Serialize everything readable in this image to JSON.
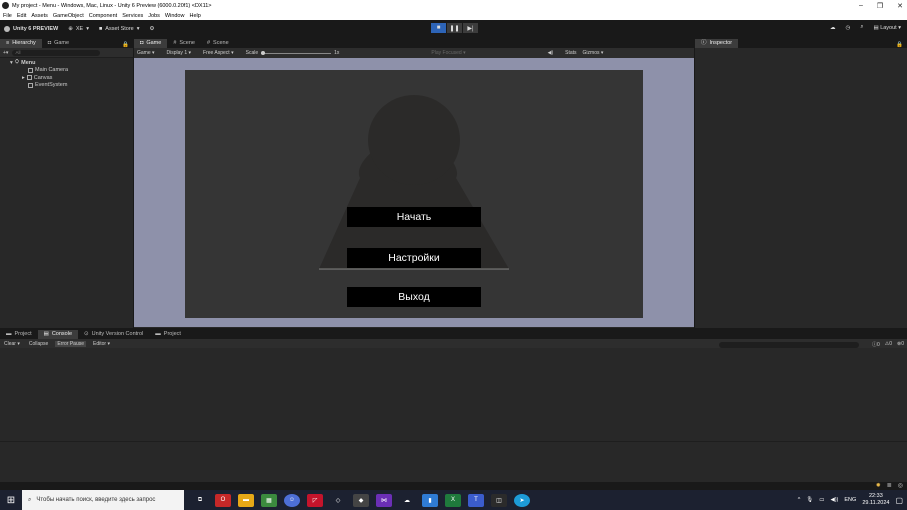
{
  "window": {
    "title": "My project - Menu - Windows, Mac, Linux - Unity 6 Preview (6000.0.20f1) <DX11>",
    "controls": [
      "–",
      "❐",
      "✕"
    ]
  },
  "menubar": [
    "File",
    "Edit",
    "Assets",
    "GameObject",
    "Component",
    "Services",
    "Jobs",
    "Window",
    "Help"
  ],
  "toolbar": {
    "brand": "Unity 6 PREVIEW",
    "account": "XE",
    "asset_store": "Asset Store",
    "layout": "Layout"
  },
  "hierarchy": {
    "tabs": [
      "Hierarchy",
      "Game"
    ],
    "search_placeholder": "All",
    "scene": "Menu",
    "items": [
      "Main Camera",
      "Canvas",
      "EventSystem"
    ]
  },
  "center": {
    "tabs": [
      "Game",
      "Scene",
      "Scene"
    ],
    "game_toolbar": {
      "mode": "Game",
      "display": "Display 1",
      "aspect": "Free Aspect",
      "scale_label": "Scale",
      "scale_value": "1x",
      "play_focused": "Play Focused",
      "stats": "Stats",
      "gizmos": "Gizmos"
    },
    "game_menu": {
      "buttons": [
        "Начать",
        "Настройки",
        "Выход"
      ],
      "colors": {
        "screen_bg": "#353535",
        "button_bg": "#000000",
        "button_text": "#ffffff",
        "silhouette": "#2b2a29"
      }
    }
  },
  "inspector": {
    "tab": "Inspector"
  },
  "bottom": {
    "tabs": [
      "Project",
      "Console",
      "Unity Version Control",
      "Project"
    ],
    "console_toolbar": [
      "Clear",
      "Collapse",
      "Error Pause",
      "Editor"
    ],
    "counts": [
      "0",
      "0",
      "0"
    ]
  },
  "taskbar": {
    "search_placeholder": "Чтобы начать поиск, введите здесь запрос",
    "lang": "ENG",
    "time": "22:33",
    "date": "29.11.2024"
  }
}
